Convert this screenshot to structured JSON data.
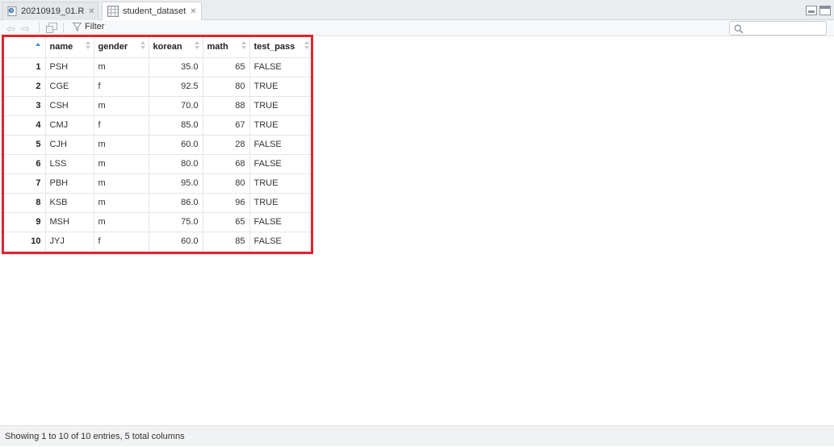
{
  "tabs": [
    {
      "label": "20210919_01.R",
      "icon": "r-script-icon"
    },
    {
      "label": "student_dataset",
      "icon": "data-grid-icon"
    }
  ],
  "toolbar": {
    "filter_label": "Filter",
    "search_placeholder": ""
  },
  "table": {
    "columns": [
      "name",
      "gender",
      "korean",
      "math",
      "test_pass"
    ],
    "rows": [
      [
        "1",
        "PSH",
        "m",
        "35.0",
        "65",
        "FALSE"
      ],
      [
        "2",
        "CGE",
        "f",
        "92.5",
        "80",
        "TRUE"
      ],
      [
        "3",
        "CSH",
        "m",
        "70.0",
        "88",
        "TRUE"
      ],
      [
        "4",
        "CMJ",
        "f",
        "85.0",
        "67",
        "TRUE"
      ],
      [
        "5",
        "CJH",
        "m",
        "60.0",
        "28",
        "FALSE"
      ],
      [
        "6",
        "LSS",
        "m",
        "80.0",
        "68",
        "FALSE"
      ],
      [
        "7",
        "PBH",
        "m",
        "95.0",
        "80",
        "TRUE"
      ],
      [
        "8",
        "KSB",
        "m",
        "86.0",
        "96",
        "TRUE"
      ],
      [
        "9",
        "MSH",
        "m",
        "75.0",
        "65",
        "FALSE"
      ],
      [
        "10",
        "JYJ",
        "f",
        "60.0",
        "85",
        "FALSE"
      ]
    ]
  },
  "status": {
    "text": "Showing 1 to 10 of 10 entries, 5 total columns"
  },
  "colors": {
    "highlight": "#e0242f",
    "sort_accent": "#3f8ad6"
  }
}
